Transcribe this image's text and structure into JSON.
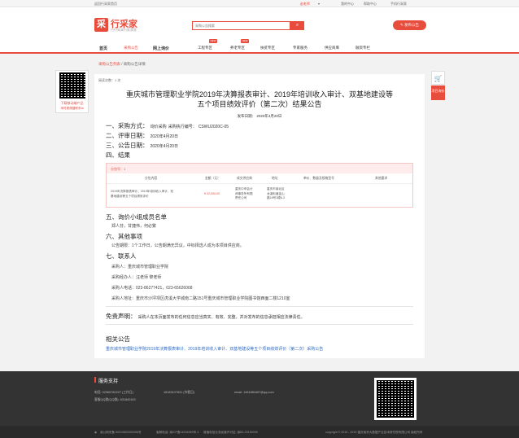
{
  "topbar": {
    "home_link": "返回行采家首页",
    "user": "赵老师",
    "my_center": "我的中心",
    "help_center": "帮助中心",
    "mobile": "手机行采家"
  },
  "header": {
    "logo_mark": "采",
    "logo_name": "行采家",
    "slogan": "行行采采行家采家",
    "search_placeholder": "采购公告搜索",
    "search_icon": "search-icon",
    "publish_label": "发布公告"
  },
  "nav": {
    "items": [
      {
        "label": "首页"
      },
      {
        "label": "采购公告"
      },
      {
        "label": "网上询价"
      },
      {
        "label": "工程专区"
      },
      {
        "label": "养老专区"
      },
      {
        "label": "扶贫专区"
      },
      {
        "label": "专家服务"
      },
      {
        "label": "供应商库"
      },
      {
        "label": "融资专栏"
      }
    ],
    "new_tag": "NEW"
  },
  "breadcrumb": {
    "link": "采购公告列表",
    "sep": "/",
    "current": "采购公告详情"
  },
  "side_qr": {
    "line1": "下载移动端产品",
    "line2": "采时更便捷联系ta"
  },
  "side_right": {
    "icon": "cart-icon",
    "label": "项目询价"
  },
  "article": {
    "read_count": "阅读次数：1 次",
    "title_line1": "重庆城市管理职业学院2019年决算报表审计、2019年培训收入审计、双基地建设等",
    "title_line2": "五个项目绩效评价（第二次）结果公告",
    "pubdate": "发布日期： 2020年4月20日",
    "s1_title": "一、采购方式：",
    "s1_method": "询价采购",
    "s1_code_label": "采购执行编号：",
    "s1_code": "CSWU2020C-05",
    "s2_title": "二、评审日期：",
    "s2_value": "2020年4月20日",
    "s3_title": "三、公告日期：",
    "s3_value": "2020年4月20日",
    "s4_title": "四、结果",
    "s5_title": "五、询价小组成员名单",
    "s5_value": "郑人芬，甘捷伟，何必繁",
    "s6_title": "六、其他事项",
    "s6_value": "公告期限：1个工作日，公告期满无异议，中标择选人成为本项目供应商。",
    "s7_title": "七、联系人",
    "c_buyer": "采购人：重庆城市管理职业学院",
    "c_agent": "采购经办人：汪老师 黎老师",
    "c_phone": "采购人电话：023-86277421，023-65626068",
    "c_addr": "采购人地址：重庆市沙坪坝区虎溪大学城南二路151号重庆城市管理职业学院图书馆西面二楼1210室",
    "disclaimer_title": "免责声明：",
    "disclaimer_text": "采购人在本页面发布的任何信息应当真实、有效、完整，并对发布的信息承担相应法律责任。",
    "related_title": "相关公告",
    "related_link": "重庆城市管理职业学院2019年决算报表审计、2019年培训收入审计、双基地建设等五个项目绩效评价（第二次）采购公告"
  },
  "result_table": {
    "package": "分包号：1",
    "headers": [
      "分包内容",
      "金额（元）",
      "成交供应商",
      "地址",
      "单价、数量及规格型号",
      "其他要求"
    ],
    "row": {
      "content_1": "2019年决算报表审计、2019年培训收入审计、双",
      "content_2": "基地建设等五个项目绩效评价",
      "amount": "¥ 32,000.00",
      "supplier_1": "重庆中甲会计",
      "supplier_2": "师事务所有限",
      "supplier_3": "责任公司",
      "addr_1": "重庆市渝北区",
      "addr_2": "龙溪街道金山",
      "addr_3": "路18号1幢6-3"
    }
  },
  "footer": {
    "title": "服务支持",
    "phone": "电话: 02365782227 (工作日)",
    "phone2": "18183107831 (节假日)",
    "email": "email: 1461884467@qq.com",
    "qq": "客服QQ群(QQ群): 831840163",
    "b1": "渝公网安备 50010802000496号",
    "b2": "客服电话: 渝ICP备14004969号-3",
    "b3": "增值电信业务经营许可证: 渝B2-20150099",
    "b4": "copyright © 2015 - 2019 重庆渝贵大数据产业技术研究院有限公司 版权所有"
  },
  "colors": {
    "brand": "#e84c3d",
    "link": "#2b6ac4",
    "footer_bg": "#333333"
  }
}
